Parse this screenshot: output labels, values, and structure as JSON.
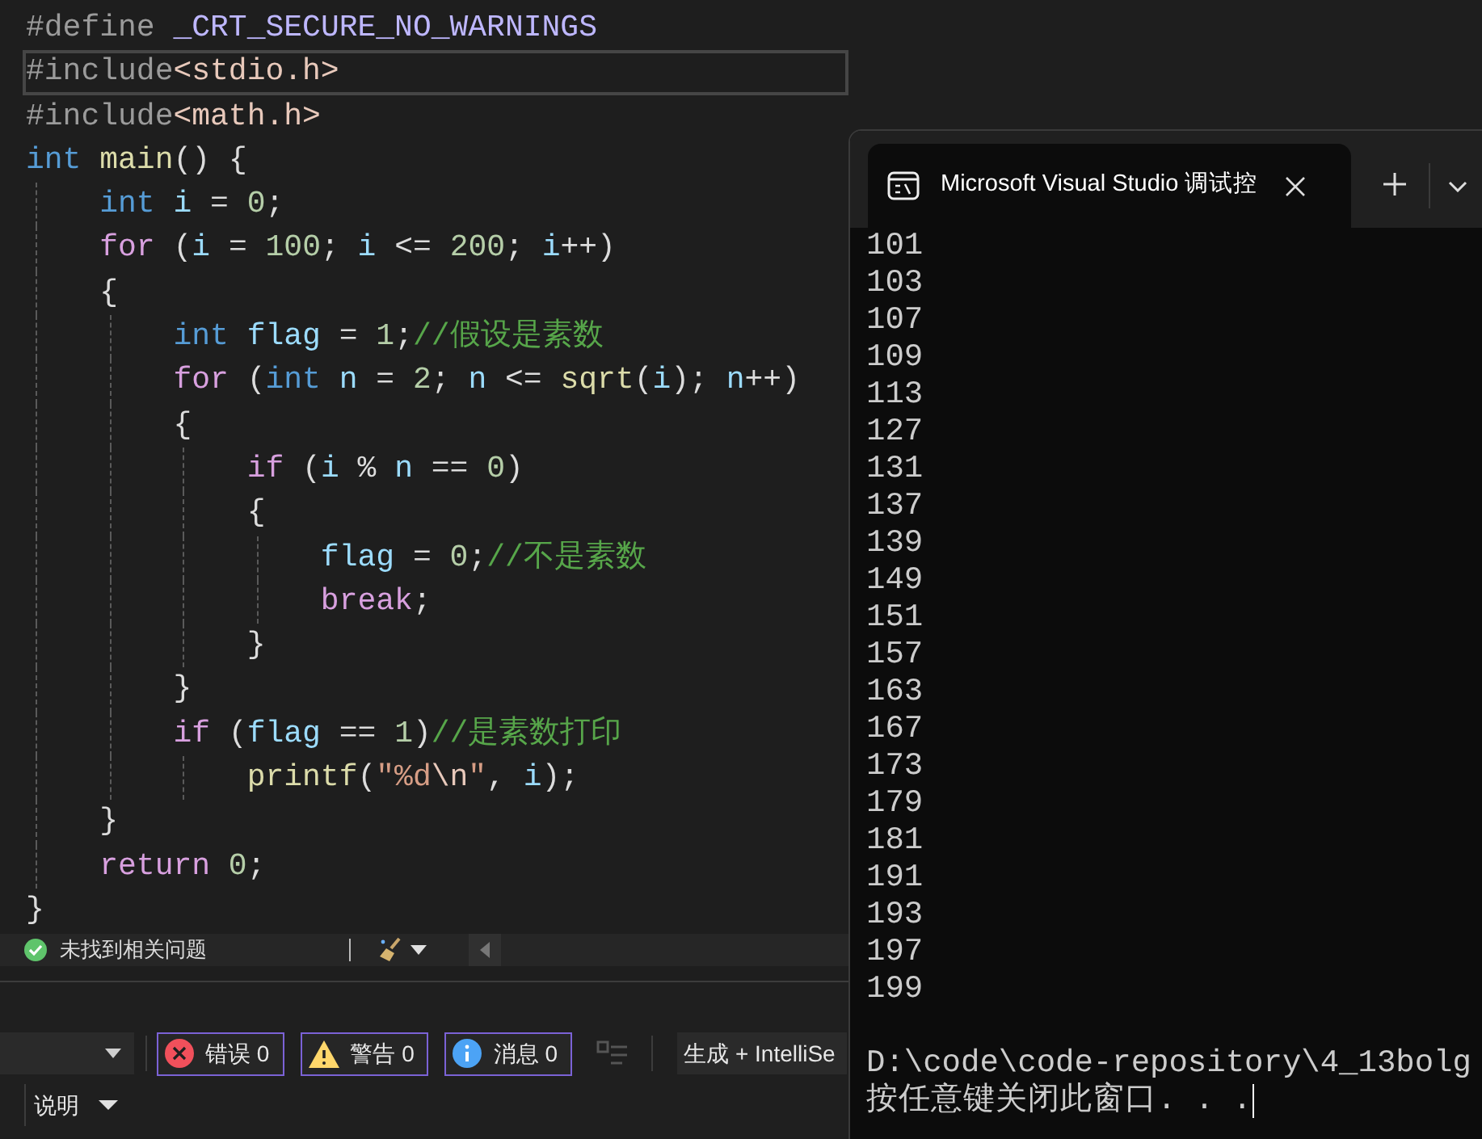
{
  "editor": {
    "lines": [
      {
        "current": false,
        "tokens": [
          {
            "kind": "preprocessor",
            "text": "#define"
          },
          {
            "kind": "macro",
            "text": " _CRT_SECURE_NO_WARNINGS"
          }
        ]
      },
      {
        "current": true,
        "tokens": [
          {
            "kind": "preprocessor",
            "text": "#include"
          },
          {
            "kind": "header",
            "text": "<stdio.h>"
          }
        ]
      },
      {
        "current": false,
        "tokens": [
          {
            "kind": "preprocessor",
            "text": "#include"
          },
          {
            "kind": "header",
            "text": "<math.h>"
          }
        ]
      },
      {
        "current": false,
        "tokens": [
          {
            "kind": "type",
            "text": "int"
          },
          {
            "kind": "function",
            "text": " main"
          },
          {
            "kind": "plain",
            "text": "() {"
          }
        ]
      },
      {
        "current": false,
        "tokens": [
          {
            "kind": "type",
            "text": "    int"
          },
          {
            "kind": "variable",
            "text": " i"
          },
          {
            "kind": "plain",
            "text": " = "
          },
          {
            "kind": "number",
            "text": "0"
          },
          {
            "kind": "plain",
            "text": ";"
          }
        ]
      },
      {
        "current": false,
        "tokens": [
          {
            "kind": "control",
            "text": "    for"
          },
          {
            "kind": "plain",
            "text": " ("
          },
          {
            "kind": "variable",
            "text": "i"
          },
          {
            "kind": "plain",
            "text": " = "
          },
          {
            "kind": "number",
            "text": "100"
          },
          {
            "kind": "plain",
            "text": "; "
          },
          {
            "kind": "variable",
            "text": "i"
          },
          {
            "kind": "plain",
            "text": " <= "
          },
          {
            "kind": "number",
            "text": "200"
          },
          {
            "kind": "plain",
            "text": "; "
          },
          {
            "kind": "variable",
            "text": "i"
          },
          {
            "kind": "plain",
            "text": "++)"
          }
        ]
      },
      {
        "current": false,
        "tokens": [
          {
            "kind": "plain",
            "text": "    {"
          }
        ]
      },
      {
        "current": false,
        "tokens": [
          {
            "kind": "type",
            "text": "        int"
          },
          {
            "kind": "variable",
            "text": " flag"
          },
          {
            "kind": "plain",
            "text": " = "
          },
          {
            "kind": "number",
            "text": "1"
          },
          {
            "kind": "plain",
            "text": ";"
          },
          {
            "kind": "comment",
            "text": "//假设是素数"
          }
        ]
      },
      {
        "current": false,
        "tokens": [
          {
            "kind": "control",
            "text": "        for"
          },
          {
            "kind": "plain",
            "text": " ("
          },
          {
            "kind": "type",
            "text": "int"
          },
          {
            "kind": "variable",
            "text": " n"
          },
          {
            "kind": "plain",
            "text": " = "
          },
          {
            "kind": "number",
            "text": "2"
          },
          {
            "kind": "plain",
            "text": "; "
          },
          {
            "kind": "variable",
            "text": "n"
          },
          {
            "kind": "plain",
            "text": " <= "
          },
          {
            "kind": "function",
            "text": "sqrt"
          },
          {
            "kind": "plain",
            "text": "("
          },
          {
            "kind": "variable",
            "text": "i"
          },
          {
            "kind": "plain",
            "text": "); "
          },
          {
            "kind": "variable",
            "text": "n"
          },
          {
            "kind": "plain",
            "text": "++)"
          }
        ]
      },
      {
        "current": false,
        "tokens": [
          {
            "kind": "plain",
            "text": "        {"
          }
        ]
      },
      {
        "current": false,
        "tokens": [
          {
            "kind": "control",
            "text": "            if"
          },
          {
            "kind": "plain",
            "text": " ("
          },
          {
            "kind": "variable",
            "text": "i"
          },
          {
            "kind": "plain",
            "text": " % "
          },
          {
            "kind": "variable",
            "text": "n"
          },
          {
            "kind": "plain",
            "text": " == "
          },
          {
            "kind": "number",
            "text": "0"
          },
          {
            "kind": "plain",
            "text": ")"
          }
        ]
      },
      {
        "current": false,
        "tokens": [
          {
            "kind": "plain",
            "text": "            {"
          }
        ]
      },
      {
        "current": false,
        "tokens": [
          {
            "kind": "variable",
            "text": "                flag"
          },
          {
            "kind": "plain",
            "text": " = "
          },
          {
            "kind": "number",
            "text": "0"
          },
          {
            "kind": "plain",
            "text": ";"
          },
          {
            "kind": "comment",
            "text": "//不是素数"
          }
        ]
      },
      {
        "current": false,
        "tokens": [
          {
            "kind": "control",
            "text": "                break"
          },
          {
            "kind": "plain",
            "text": ";"
          }
        ]
      },
      {
        "current": false,
        "tokens": [
          {
            "kind": "plain",
            "text": "            }"
          }
        ]
      },
      {
        "current": false,
        "tokens": [
          {
            "kind": "plain",
            "text": "        }"
          }
        ]
      },
      {
        "current": false,
        "tokens": [
          {
            "kind": "control",
            "text": "        if"
          },
          {
            "kind": "plain",
            "text": " ("
          },
          {
            "kind": "variable",
            "text": "flag"
          },
          {
            "kind": "plain",
            "text": " == "
          },
          {
            "kind": "number",
            "text": "1"
          },
          {
            "kind": "plain",
            "text": ")"
          },
          {
            "kind": "comment",
            "text": "//是素数打印"
          }
        ]
      },
      {
        "current": false,
        "tokens": [
          {
            "kind": "function",
            "text": "            printf"
          },
          {
            "kind": "plain",
            "text": "("
          },
          {
            "kind": "string",
            "text": "\"%d"
          },
          {
            "kind": "escape",
            "text": "\\n"
          },
          {
            "kind": "string",
            "text": "\""
          },
          {
            "kind": "plain",
            "text": ", "
          },
          {
            "kind": "variable",
            "text": "i"
          },
          {
            "kind": "plain",
            "text": ");"
          }
        ]
      },
      {
        "current": false,
        "tokens": [
          {
            "kind": "plain",
            "text": "    }"
          }
        ]
      },
      {
        "current": false,
        "tokens": [
          {
            "kind": "control",
            "text": "    return"
          },
          {
            "kind": "number",
            "text": " 0"
          },
          {
            "kind": "plain",
            "text": ";"
          }
        ]
      },
      {
        "current": false,
        "tokens": [
          {
            "kind": "plain",
            "text": "}"
          }
        ]
      }
    ]
  },
  "status_bar": {
    "ok": true,
    "message": "未找到相关问题"
  },
  "error_list": {
    "filters": [
      {
        "kind": "error",
        "label": "错误 0",
        "selected": true
      },
      {
        "kind": "warning",
        "label": "警告 0",
        "selected": true
      },
      {
        "kind": "info",
        "label": "消息 0",
        "selected": true
      }
    ],
    "build_dropdown": "生成 + IntelliSe",
    "column": "说明"
  },
  "terminal": {
    "tab_title": "Microsoft Visual Studio 调试控",
    "output": [
      "101",
      "103",
      "107",
      "109",
      "113",
      "127",
      "131",
      "137",
      "139",
      "149",
      "151",
      "157",
      "163",
      "167",
      "173",
      "179",
      "181",
      "191",
      "193",
      "197",
      "199"
    ],
    "exit_message": [
      "D:\\code\\code-repository\\4_13bolg",
      "按任意键关闭此窗口. . ."
    ]
  }
}
